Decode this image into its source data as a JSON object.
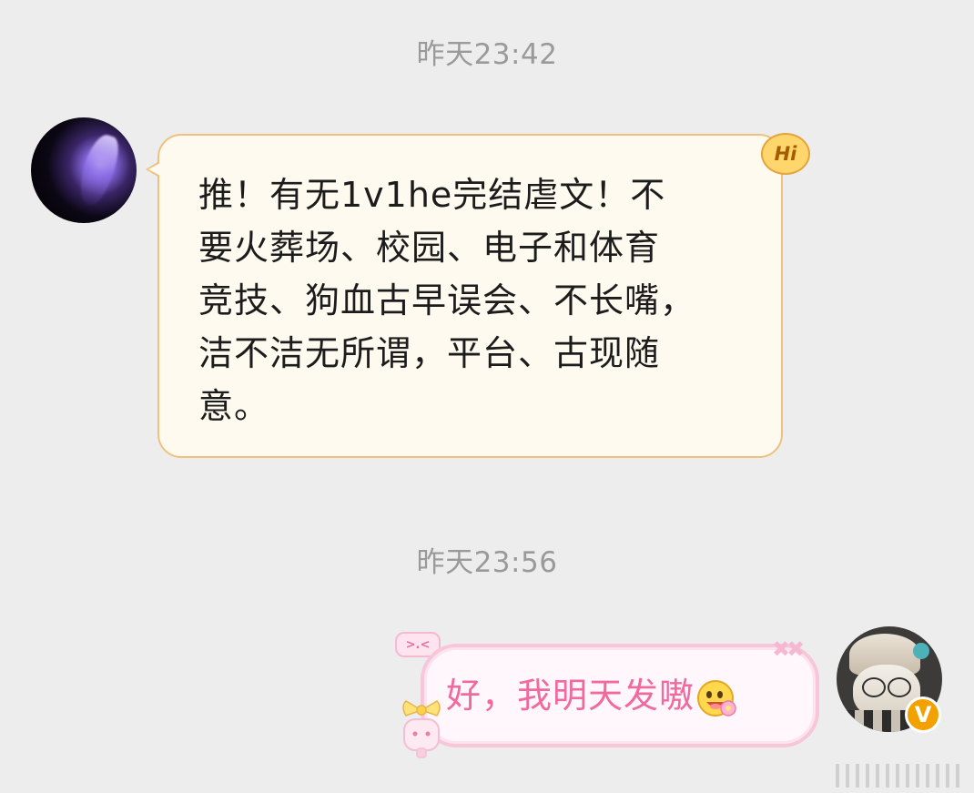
{
  "conversation": {
    "messages": [
      {
        "timestamp": "昨天23:42",
        "sender": "other",
        "text": "推！有无1v1he完结虐文！不\n要火葬场、校园、电子和体育\n竞技、狗血古早误会、不长嘴，\n洁不洁无所谓，平台、古现随\n意。",
        "badge": "Hi"
      },
      {
        "timestamp": "昨天23:56",
        "sender": "self",
        "text": "好，我明天发嗷",
        "emoji": "sticker-emoji-icon",
        "avatar_badge": "V"
      }
    ]
  },
  "decorations": {
    "tag_text": ">.<",
    "sparkle_text": "✖✖"
  },
  "colors": {
    "background": "#ededed",
    "timestamp": "#9a9a9a",
    "left_bubble_bg": "#fffaf0",
    "left_bubble_border": "#efc07e",
    "right_bubble_bg": "#fff7fb",
    "right_bubble_border": "#f7c6d9",
    "right_text": "#f06a9f",
    "verify_badge": "#f2a100"
  }
}
